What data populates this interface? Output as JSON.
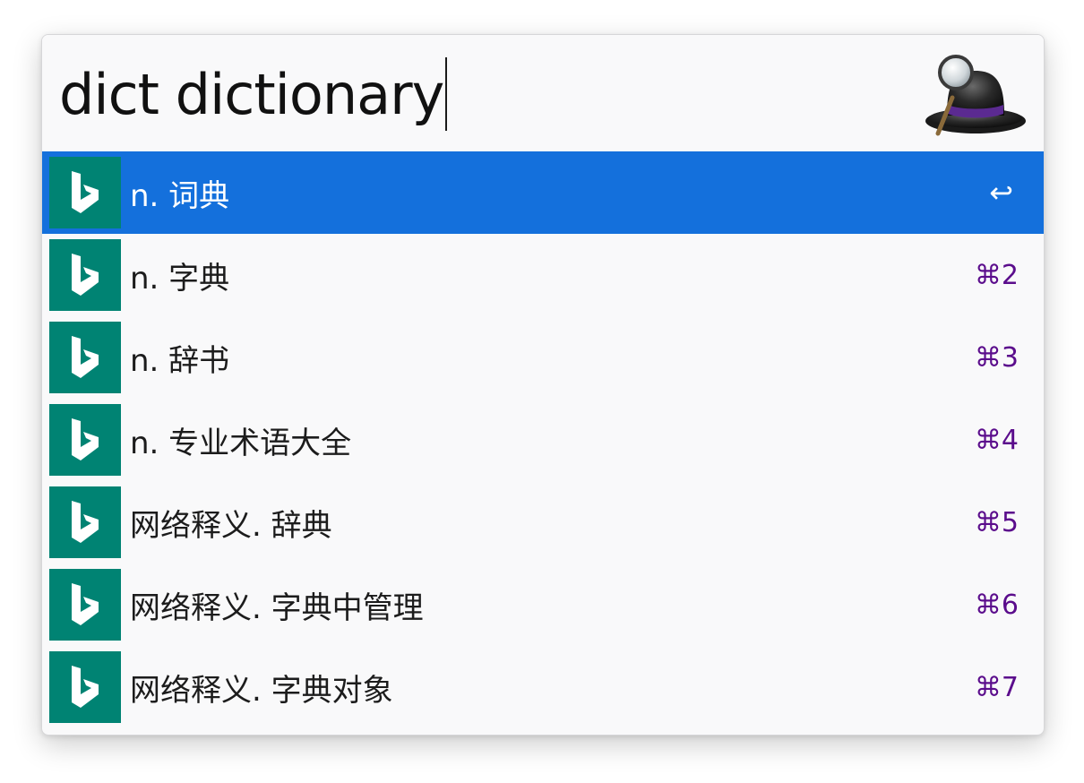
{
  "search": {
    "query": "dict dictionary"
  },
  "app": {
    "logo_icon": "alfred-hat-icon"
  },
  "colors": {
    "selected_row": "#1470dc",
    "icon_bg": "#008373",
    "shortcut": "#5b0d8c"
  },
  "results": [
    {
      "label": "n. 词典",
      "shortcut": "↩",
      "icon": "bing-icon",
      "selected": true
    },
    {
      "label": "n. 字典",
      "shortcut": "⌘2",
      "icon": "bing-icon",
      "selected": false
    },
    {
      "label": "n. 辞书",
      "shortcut": "⌘3",
      "icon": "bing-icon",
      "selected": false
    },
    {
      "label": "n. 专业术语大全",
      "shortcut": "⌘4",
      "icon": "bing-icon",
      "selected": false
    },
    {
      "label": "网络释义. 辞典",
      "shortcut": "⌘5",
      "icon": "bing-icon",
      "selected": false
    },
    {
      "label": "网络释义. 字典中管理",
      "shortcut": "⌘6",
      "icon": "bing-icon",
      "selected": false
    },
    {
      "label": "网络释义. 字典对象",
      "shortcut": "⌘7",
      "icon": "bing-icon",
      "selected": false
    }
  ]
}
